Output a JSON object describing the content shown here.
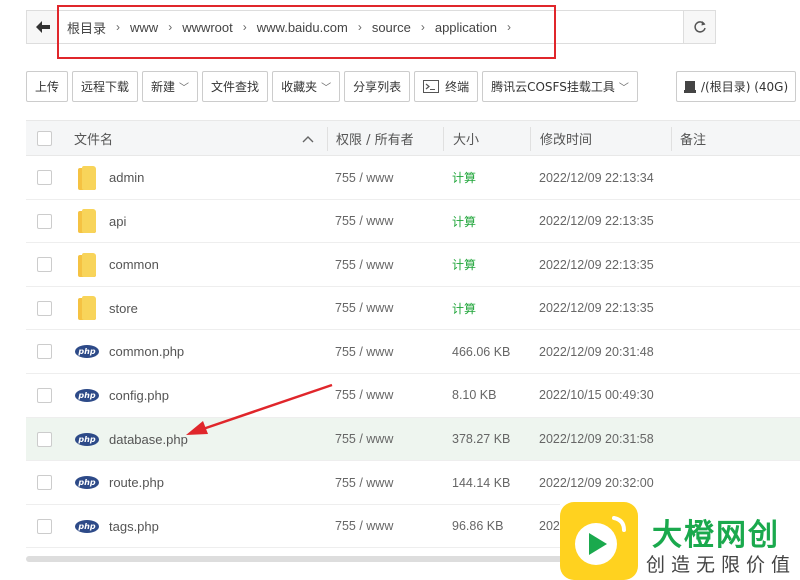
{
  "breadcrumb": {
    "segments": [
      "根目录",
      "www",
      "wwwroot",
      "www.baidu.com",
      "source",
      "application"
    ]
  },
  "toolbar": {
    "upload": "上传",
    "remote_download": "远程下载",
    "new": "新建",
    "file_search": "文件查找",
    "favorites": "收藏夹",
    "share_list": "分享列表",
    "terminal": "终端",
    "cosfs": "腾讯云COSFS挂载工具",
    "disk": "/(根目录) (40G)"
  },
  "table": {
    "headers": {
      "name": "文件名",
      "perm": "权限 / 所有者",
      "size": "大小",
      "mtime": "修改时间",
      "note": "备注"
    },
    "rows": [
      {
        "type": "folder",
        "name": "admin",
        "perm": "755 / www",
        "size": "计算",
        "mtime": "2022/12/09 22:13:34"
      },
      {
        "type": "folder",
        "name": "api",
        "perm": "755 / www",
        "size": "计算",
        "mtime": "2022/12/09 22:13:35"
      },
      {
        "type": "folder",
        "name": "common",
        "perm": "755 / www",
        "size": "计算",
        "mtime": "2022/12/09 22:13:35"
      },
      {
        "type": "folder",
        "name": "store",
        "perm": "755 / www",
        "size": "计算",
        "mtime": "2022/12/09 22:13:35"
      },
      {
        "type": "php",
        "name": "common.php",
        "perm": "755 / www",
        "size": "466.06 KB",
        "mtime": "2022/12/09 20:31:48"
      },
      {
        "type": "php",
        "name": "config.php",
        "perm": "755 / www",
        "size": "8.10 KB",
        "mtime": "2022/10/15 00:49:30"
      },
      {
        "type": "php",
        "name": "database.php",
        "perm": "755 / www",
        "size": "378.27 KB",
        "mtime": "2022/12/09 20:31:58"
      },
      {
        "type": "php",
        "name": "route.php",
        "perm": "755 / www",
        "size": "144.14 KB",
        "mtime": "2022/12/09 20:32:00"
      },
      {
        "type": "php",
        "name": "tags.php",
        "perm": "755 / www",
        "size": "96.86 KB",
        "mtime": "202"
      }
    ]
  },
  "php_icon_label": "php",
  "logo": {
    "name": "大橙网创",
    "slogan": "创造无限价值"
  },
  "colors": {
    "highlight": "#e0262b",
    "calc_green": "#20a53a",
    "brand_green": "#1aa94d",
    "brand_yellow": "#ffd21f"
  }
}
